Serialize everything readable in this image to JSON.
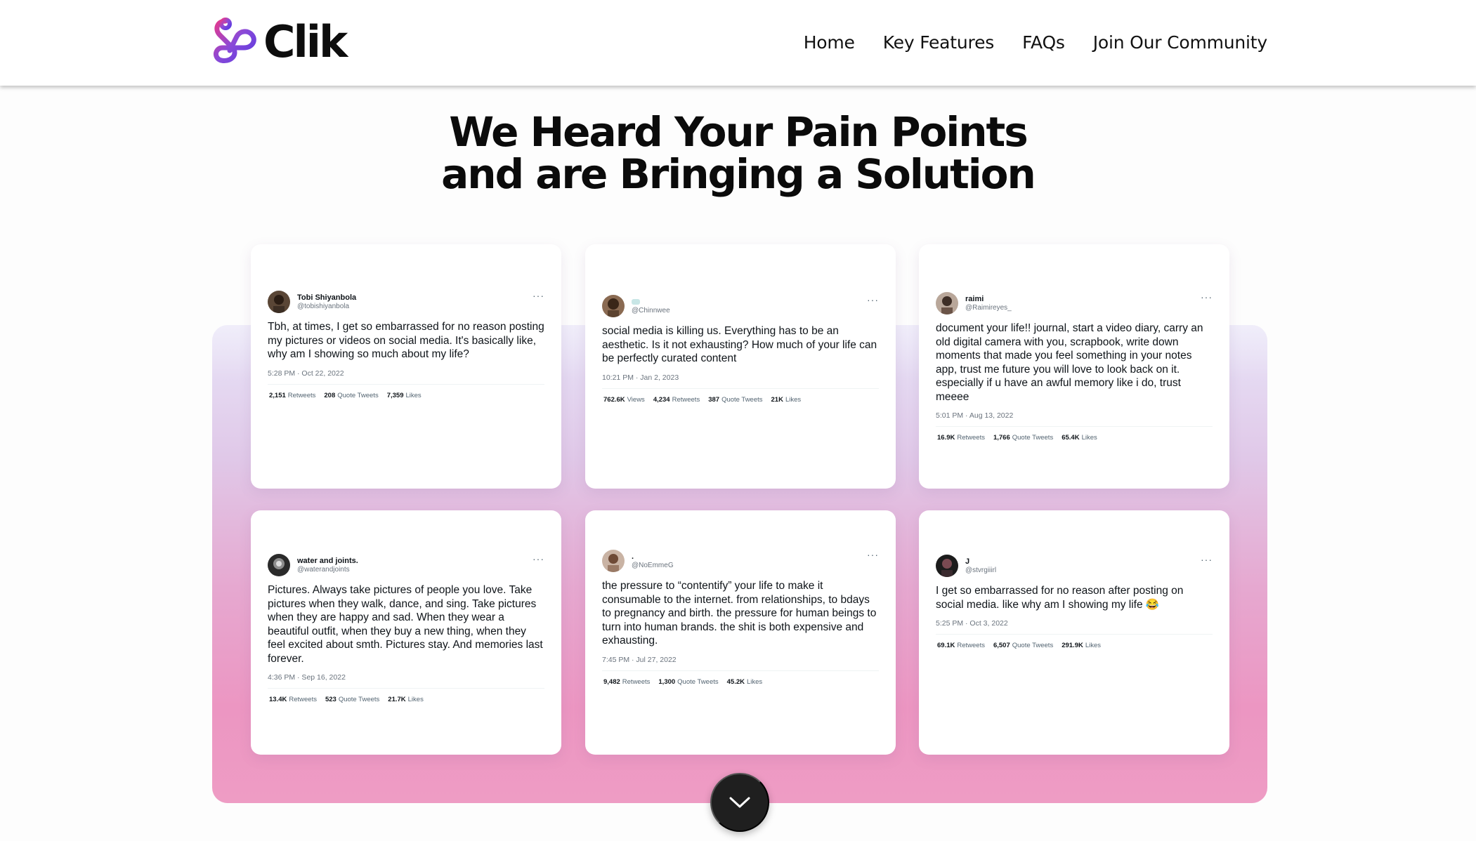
{
  "header": {
    "brand_name": "Clik",
    "brand_icon": "clik-logo-icon",
    "nav": [
      {
        "label": "Home"
      },
      {
        "label": "Key Features"
      },
      {
        "label": "FAQs"
      },
      {
        "label": "Join Our Community"
      }
    ]
  },
  "hero": {
    "line1": "We Heard Your Pain Points",
    "line2": "and are Bringing a Solution"
  },
  "colors": {
    "panel_top": "#e8e4f8",
    "panel_bottom": "#ee9cc4",
    "button_bg": "#1f1f1f",
    "brand_gradient": [
      "#e23a8f",
      "#8a4ad8",
      "#5b3ae0"
    ]
  },
  "tweets": [
    {
      "author": "Tobi Shiyanbola",
      "handle": "@tobishiyanbola",
      "text": "Tbh, at times, I get so embarrassed for no reason posting my pictures or videos on social media. It's basically like, why am I showing so much about my life?",
      "meta": "5:28 PM · Oct 22, 2022",
      "stats": [
        {
          "value": "2,151",
          "label": "Retweets"
        },
        {
          "value": "208",
          "label": "Quote Tweets"
        },
        {
          "value": "7,359",
          "label": "Likes"
        }
      ]
    },
    {
      "author": "",
      "handle": "@Chinnwee",
      "text": "social media is killing us. Everything has to be an aesthetic. Is it not exhausting? How much of your life can be perfectly curated content",
      "meta": "10:21 PM · Jan 2, 2023",
      "stats": [
        {
          "value": "762.6K",
          "label": "Views"
        },
        {
          "value": "4,234",
          "label": "Retweets"
        },
        {
          "value": "387",
          "label": "Quote Tweets"
        },
        {
          "value": "21K",
          "label": "Likes"
        }
      ]
    },
    {
      "author": "raimi",
      "handle": "@Raimireyes_",
      "text": "document your life!! journal, start a video diary, carry an old digital camera with you, scrapbook, write down moments that made you feel something in your notes app, trust me future you will love to look back on it. especially if u have an awful memory like i do, trust meeee",
      "meta": "5:01 PM · Aug 13, 2022",
      "stats": [
        {
          "value": "16.9K",
          "label": "Retweets"
        },
        {
          "value": "1,766",
          "label": "Quote Tweets"
        },
        {
          "value": "65.4K",
          "label": "Likes"
        }
      ]
    },
    {
      "author": "water and joints.",
      "handle": "@waterandjoints",
      "text": "Pictures. Always take pictures of people you love. Take pictures when they walk, dance, and sing. Take pictures when they are happy and sad. When they wear a beautiful outfit, when they buy a new thing, when they feel excited about smth. Pictures stay. And memories last forever.",
      "meta": "4:36 PM · Sep 16, 2022",
      "stats": [
        {
          "value": "13.4K",
          "label": "Retweets"
        },
        {
          "value": "523",
          "label": "Quote Tweets"
        },
        {
          "value": "21.7K",
          "label": "Likes"
        }
      ]
    },
    {
      "author": ".",
      "handle": "@NoEmmeG",
      "text": "the pressure to “contentify” your life to make it consumable to the internet.  from relationships, to bdays to pregnancy and birth. the pressure for human beings to turn into human brands. the shit is both expensive and exhausting.",
      "meta": "7:45 PM · Jul 27, 2022",
      "stats": [
        {
          "value": "9,482",
          "label": "Retweets"
        },
        {
          "value": "1,300",
          "label": "Quote Tweets"
        },
        {
          "value": "45.2K",
          "label": "Likes"
        }
      ]
    },
    {
      "author": "J",
      "handle": "@stvrgiiirl",
      "text": "I get so embarrassed for no reason after posting on social media. like why am I showing my life 😂",
      "meta": "5:25 PM · Oct 3, 2022",
      "stats": [
        {
          "value": "69.1K",
          "label": "Retweets"
        },
        {
          "value": "6,507",
          "label": "Quote Tweets"
        },
        {
          "value": "291.9K",
          "label": "Likes"
        }
      ]
    }
  ],
  "scroll_button": {
    "icon": "chevron-down-icon"
  }
}
